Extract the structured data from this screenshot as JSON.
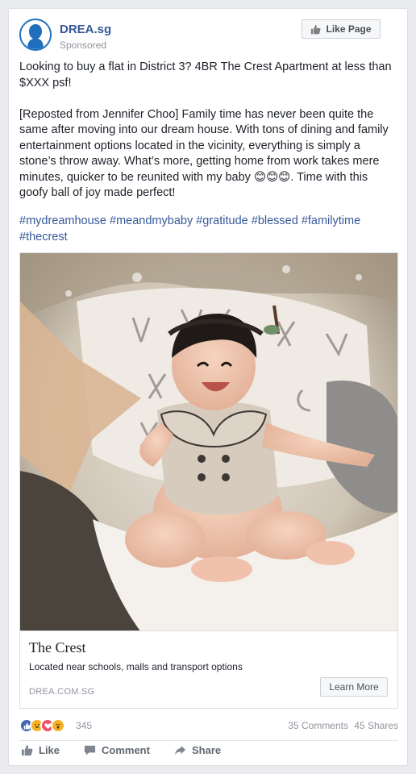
{
  "post": {
    "page_name": "DREA.sg",
    "sponsored": "Sponsored",
    "like_page_label": "Like Page",
    "text": "Looking to buy a flat in District 3? 4BR The Crest Apartment at less than $XXX psf!\n\n[Reposted from Jennifer Choo] Family time has never been quite the same after moving into our dream house. With tons of dining and family entertainment options located in the vicinity, everything is simply a stone’s throw away. What’s more, getting home from work takes mere minutes, quicker to be reunited with my baby 😊😊😊. Time with this goofy ball of joy made perfect!",
    "hashtags": "#mydreamhouse #meandmybaby #gratitude #blessed #familytime\n#thecrest"
  },
  "link": {
    "title": "The Crest",
    "description": "Located near schools, malls and transport options",
    "domain": "DREA.COM.SG",
    "cta_label": "Learn More"
  },
  "stats": {
    "reaction_count": "345",
    "comments": "35 Comments",
    "shares": "45 Shares"
  },
  "actions": {
    "like": "Like",
    "comment": "Comment",
    "share": "Share"
  },
  "colors": {
    "link_blue": "#365899",
    "brand_blue": "#1f6fbd",
    "like_blue": "#4267b2",
    "love_red": "#f25268",
    "haha_yellow": "#f7b125"
  },
  "icons": {
    "avatar": "person-silhouette-icon",
    "like_page": "thumbs-up-icon",
    "comment": "speech-bubble-icon",
    "share": "share-arrow-icon"
  }
}
